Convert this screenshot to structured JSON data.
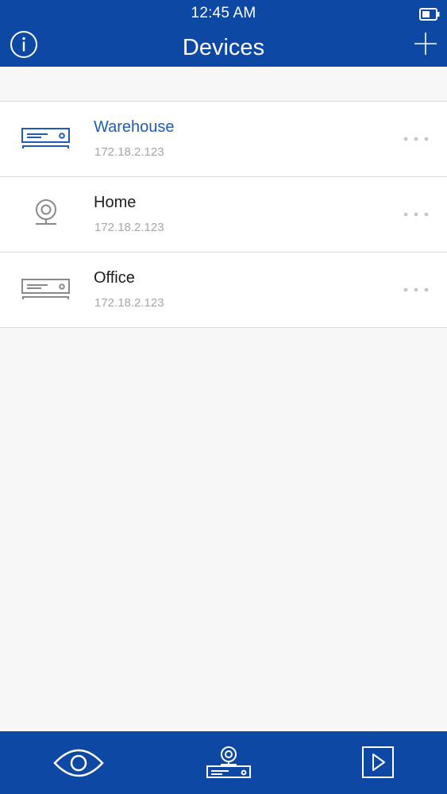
{
  "status_bar": {
    "time": "12:45 AM",
    "battery_icon": "battery-icon"
  },
  "header": {
    "title": "Devices",
    "info_icon": "info-icon",
    "add_icon": "plus-icon"
  },
  "devices": [
    {
      "name": "Warehouse",
      "ip": "172.18.2.123",
      "type": "recorder",
      "selected": true
    },
    {
      "name": "Home",
      "ip": "172.18.2.123",
      "type": "camera",
      "selected": false
    },
    {
      "name": "Office",
      "ip": "172.18.2.123",
      "type": "recorder",
      "selected": false
    }
  ],
  "tabbar": {
    "tabs": [
      {
        "id": "live",
        "icon": "eye-icon"
      },
      {
        "id": "devices",
        "icon": "device-icon"
      },
      {
        "id": "playback",
        "icon": "play-icon"
      }
    ]
  },
  "colors": {
    "primary": "#0c48a4",
    "selected_text": "#1e5db6",
    "icon_gray": "#8a8a8a",
    "ip_gray": "#a6a6a6",
    "background": "#f7f7f7"
  }
}
